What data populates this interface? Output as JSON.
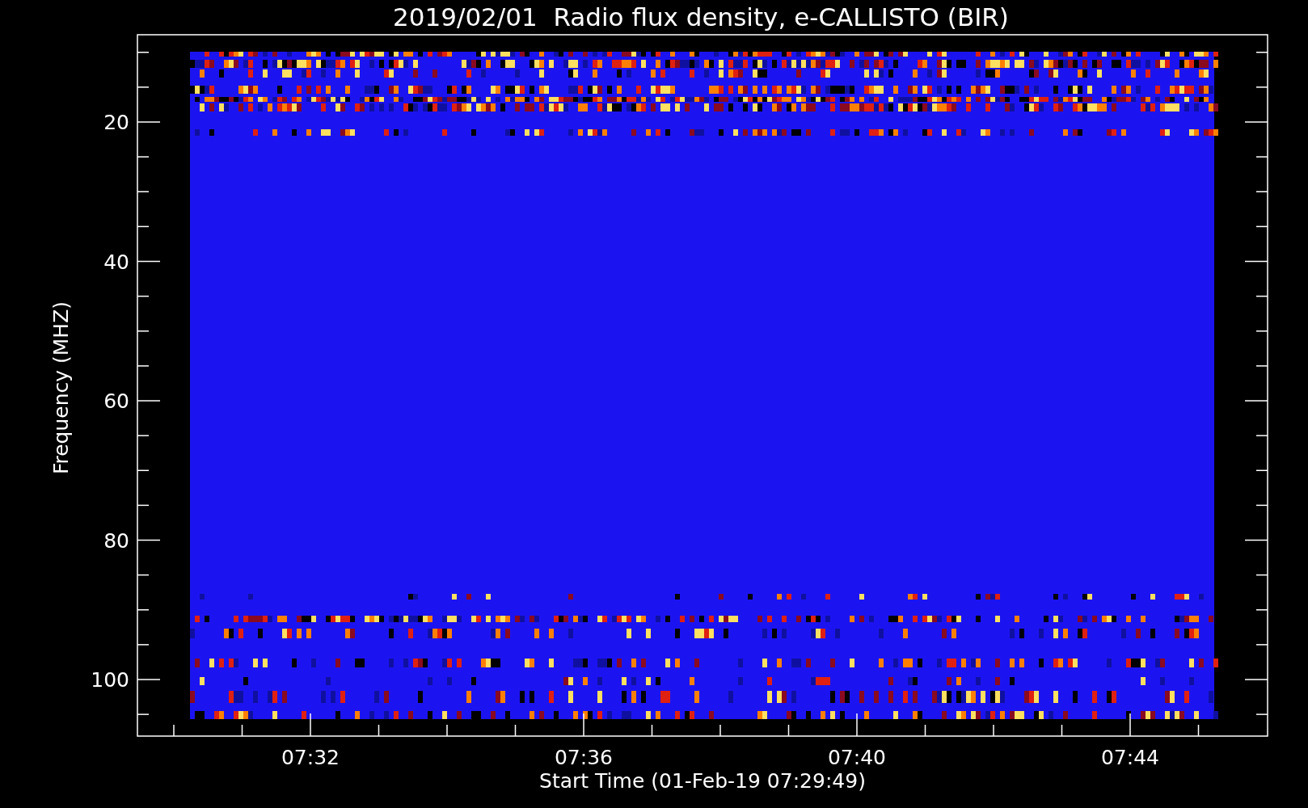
{
  "plot": {
    "title": "2019/02/01  Radio flux density, e-CALLISTO (BIR)",
    "ylabel": "Frequency (MHZ)",
    "xlabel": "Start Time (01-Feb-19 07:29:49)",
    "yticks": [
      "20",
      "40",
      "60",
      "80",
      "100"
    ],
    "xticks": [
      "07:32",
      "07:36",
      "07:40",
      "07:44"
    ]
  }
}
